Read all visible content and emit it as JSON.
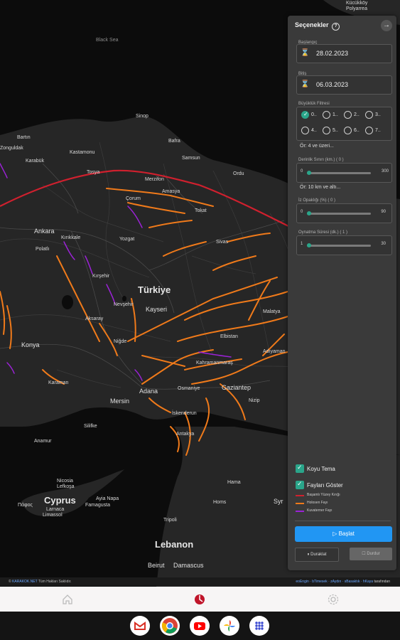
{
  "map": {
    "labels": {
      "black_sea": "Black Sea",
      "turkey": "Türkiye",
      "cyprus": "Cyprus",
      "lebanon": "Lebanon",
      "syria_partial": "Syr",
      "kucukkoy": "Kücükköy",
      "polyarrea": "Polyarrea",
      "sinop": "Sinop",
      "bartin": "Bartın",
      "zonguldak": "Zonguldak",
      "kastamonu": "Kastamonu",
      "samsun": "Samsun",
      "bafra": "Bafra",
      "ordu": "Ordu",
      "merzifon": "Merzifon",
      "corum": "Çorum",
      "amasya": "Amasya",
      "tokat": "Tokat",
      "sivas": "Sivas",
      "karabuk": "Karabük",
      "tosya": "Tosya",
      "ankara": "Ankara",
      "kirikkale": "Kırıkkale",
      "polatli": "Polatlı",
      "yozgat": "Yozgat",
      "kirsehir": "Kırşehir",
      "aksaray": "Aksaray",
      "nevsehir": "Nevşehir",
      "kayseri": "Kayseri",
      "konya": "Konya",
      "karaman": "Karaman",
      "nigde": "Niğde",
      "kahramanmaras": "Kahramanmaraş",
      "adana": "Adana",
      "osmaniye": "Osmaniye",
      "gaziantep": "Gaziantep",
      "mersin": "Mersin",
      "silifke": "Silifke",
      "anamur": "Anamur",
      "iskenderun": "İskenderun",
      "antakya": "Antakya",
      "adiyaman": "Adıyaman",
      "malatya": "Malatya",
      "elbistan": "Elbistan",
      "nizip": "Nizip",
      "nicosia": "Nicosia",
      "lefkosa": "Lefkoşa",
      "famagusta": "Famagusta",
      "larnaca": "Larnaca",
      "paphos": "Πάφος",
      "limassol": "Limassol",
      "ayia_napa": "Ayia Napa",
      "tripoli": "Tripoli",
      "beirut": "Beirut",
      "damascus": "Damascus",
      "homs": "Homs",
      "hama": "Hama"
    }
  },
  "panel": {
    "title": "Seçenekler",
    "help_icon": "help-circle-icon",
    "close_icon": "arrow-right-circle-icon",
    "start_label": "Başlangıç",
    "start_value": "28.02.2023",
    "end_label": "Bitiş",
    "end_value": "06.03.2023",
    "magnitude_label": "Büyüklük Filtresi",
    "magnitudes": [
      {
        "label": "0..",
        "checked": true
      },
      {
        "label": "1..",
        "checked": false
      },
      {
        "label": "2..",
        "checked": false
      },
      {
        "label": "3..",
        "checked": false
      },
      {
        "label": "4..",
        "checked": false
      },
      {
        "label": "5..",
        "checked": false
      },
      {
        "label": "6..",
        "checked": false
      },
      {
        "label": "7..",
        "checked": false
      }
    ],
    "magnitude_note": "Ör: 4 ve üzeri...",
    "depth_label": "Derinlik Sınırı (km.) ( 0 )",
    "depth_min": "0",
    "depth_max": "300",
    "depth_value": 0,
    "depth_note": "Ör: 10 km ve altı...",
    "opacity_label": "İz Opaklığı (%) ( 0 )",
    "opacity_min": "0",
    "opacity_max": "90",
    "opacity_value": 0,
    "duration_label": "Oynatma Süresi (dk.) ( 1 )",
    "duration_min": "1",
    "duration_max": "30",
    "duration_value": 1,
    "dark_theme_label": "Koyu Tema",
    "show_faults_label": "Fayları Göster",
    "legend": [
      {
        "label": "Başamlı Yüzey Kırığı",
        "color": "#d0202e"
      },
      {
        "label": "Holosen Fayı",
        "color": "#f07a1a"
      },
      {
        "label": "Kuvaterner Fayı",
        "color": "#9b22d6"
      }
    ],
    "start_button": "▷ Başlat",
    "pause_button": "⏸ Duraklat",
    "stop_button": "☐ Durdur"
  },
  "attribution": {
    "left_prefix": "©",
    "left_brand": "KARAKOK.NET",
    "left_rest": "Tüm Hakları Saklıdır.",
    "right_links": "eoEngin · bTimesek · zAydın · sBasaktık · hKaya",
    "right_suffix": "tarafından"
  },
  "bottom_nav": {
    "home_icon": "home-icon",
    "center_icon": "app-logo-icon",
    "settings_icon": "gear-icon"
  },
  "dock": {
    "apps": [
      "gmail-icon",
      "chrome-icon",
      "youtube-icon",
      "photos-icon",
      "apps-grid-icon"
    ]
  }
}
